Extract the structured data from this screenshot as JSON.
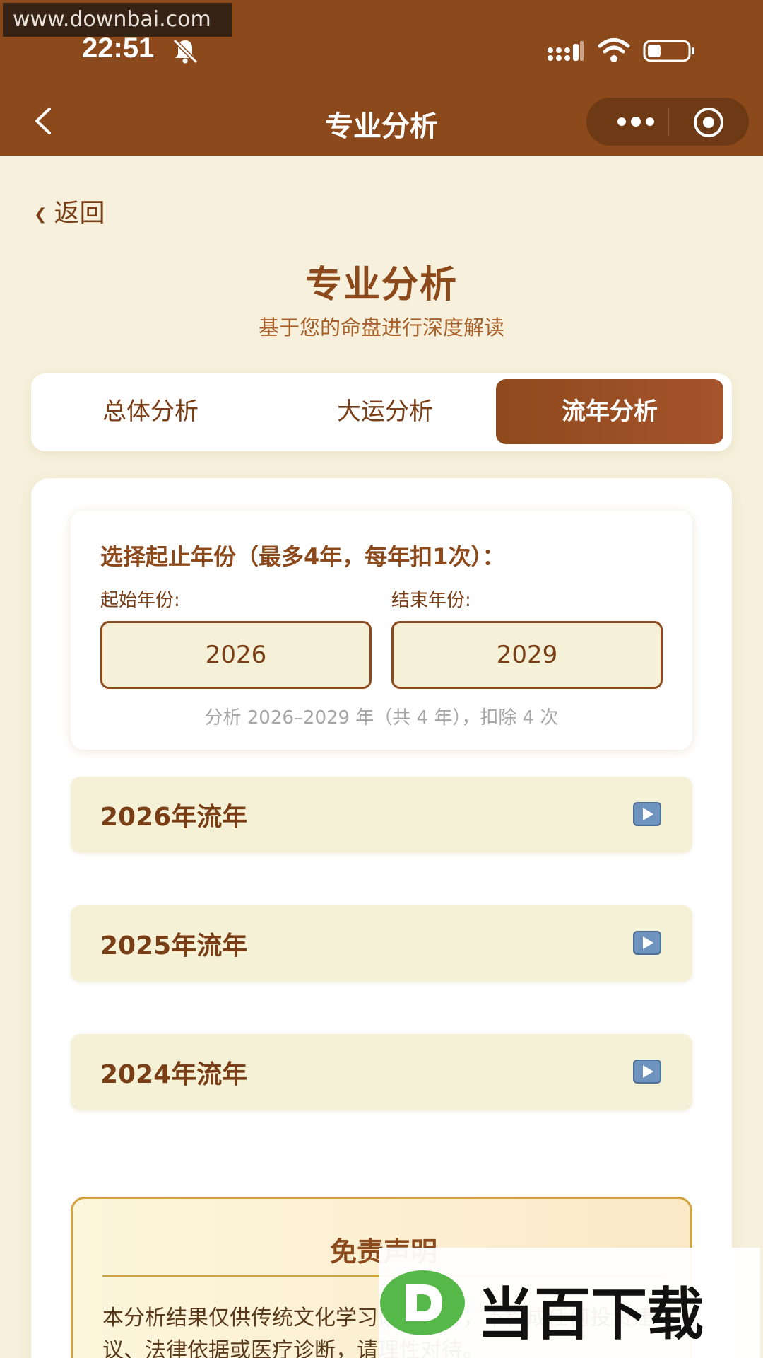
{
  "status_bar": {
    "watermark": "www.downbai.com",
    "time": "22:51"
  },
  "nav": {
    "title": "专业分析"
  },
  "page": {
    "back": "返回",
    "title": "专业分析",
    "subtitle": "基于您的命盘进行深度解读"
  },
  "tabs": [
    {
      "label": "总体分析",
      "active": false
    },
    {
      "label": "大运分析",
      "active": false
    },
    {
      "label": "流年分析",
      "active": true
    }
  ],
  "year_selector": {
    "heading": "选择起止年份（最多4年，每年扣1次）：",
    "start_label": "起始年份:",
    "end_label": "结束年份:",
    "start_value": "2026",
    "end_value": "2029",
    "summary": "分析 2026–2029 年（共 4 年），扣除 4 次"
  },
  "year_rows": [
    {
      "label": "2026年流年",
      "icon": "play-icon"
    },
    {
      "label": "2025年流年",
      "icon": "play-icon"
    },
    {
      "label": "2024年流年",
      "icon": "play-icon"
    }
  ],
  "disclaimer": {
    "title": "免责声明",
    "text": "本分析结果仅供传统文化学习研究参考，不构成任何投资建议、法律依据或医疗诊断，请理性对待。"
  },
  "overlay_logo": {
    "text": "当百下载"
  },
  "colors": {
    "brand": "#8c4a1c",
    "background": "#f6f0dc",
    "row": "#f4f1d6",
    "accent": "#d4a23c"
  }
}
